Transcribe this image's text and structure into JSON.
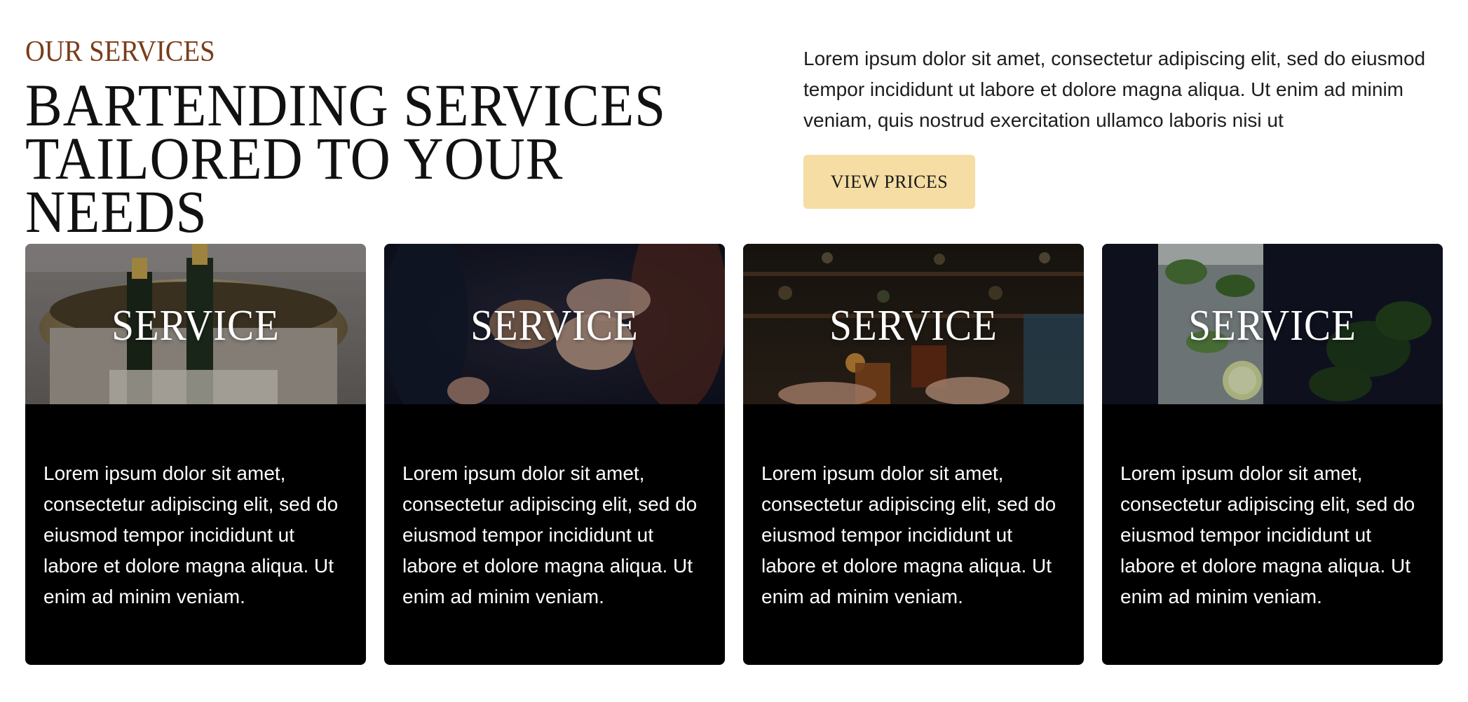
{
  "header": {
    "eyebrow": "OUR SERVICES",
    "headline_line1": "BARTENDING SERVICES",
    "headline_line2": "TAILORED TO YOUR NEEDS",
    "intro": "Lorem ipsum dolor sit amet, consectetur adipiscing elit, sed do eiusmod tempor incididunt ut labore et dolore magna aliqua. Ut enim ad minim veniam, quis nostrud exercitation ullamco laboris nisi ut",
    "cta_label": "VIEW PRICES"
  },
  "colors": {
    "eyebrow": "#7a3c1a",
    "cta_background": "#f5dda3",
    "card_background": "#000000"
  },
  "cards": [
    {
      "title": "SERVICE",
      "image": "champagne-bucket-photo",
      "text": "Lorem ipsum dolor sit amet, consectetur adipiscing elit, sed do eiusmod tempor incididunt ut labore et dolore magna aliqua. Ut enim ad minim veniam."
    },
    {
      "title": "SERVICE",
      "image": "toasting-cocktails-photo",
      "text": "Lorem ipsum dolor sit amet, consectetur adipiscing elit, sed do eiusmod tempor incididunt ut labore et dolore magna aliqua. Ut enim ad minim veniam."
    },
    {
      "title": "SERVICE",
      "image": "bar-cheers-photo",
      "text": "Lorem ipsum dolor sit amet, consectetur adipiscing elit, sed do eiusmod tempor incididunt ut labore et dolore magna aliqua. Ut enim ad minim veniam."
    },
    {
      "title": "SERVICE",
      "image": "mojito-glass-photo",
      "text": "Lorem ipsum dolor sit amet, consectetur adipiscing elit, sed do eiusmod tempor incididunt ut labore et dolore magna aliqua. Ut enim ad minim veniam."
    }
  ]
}
